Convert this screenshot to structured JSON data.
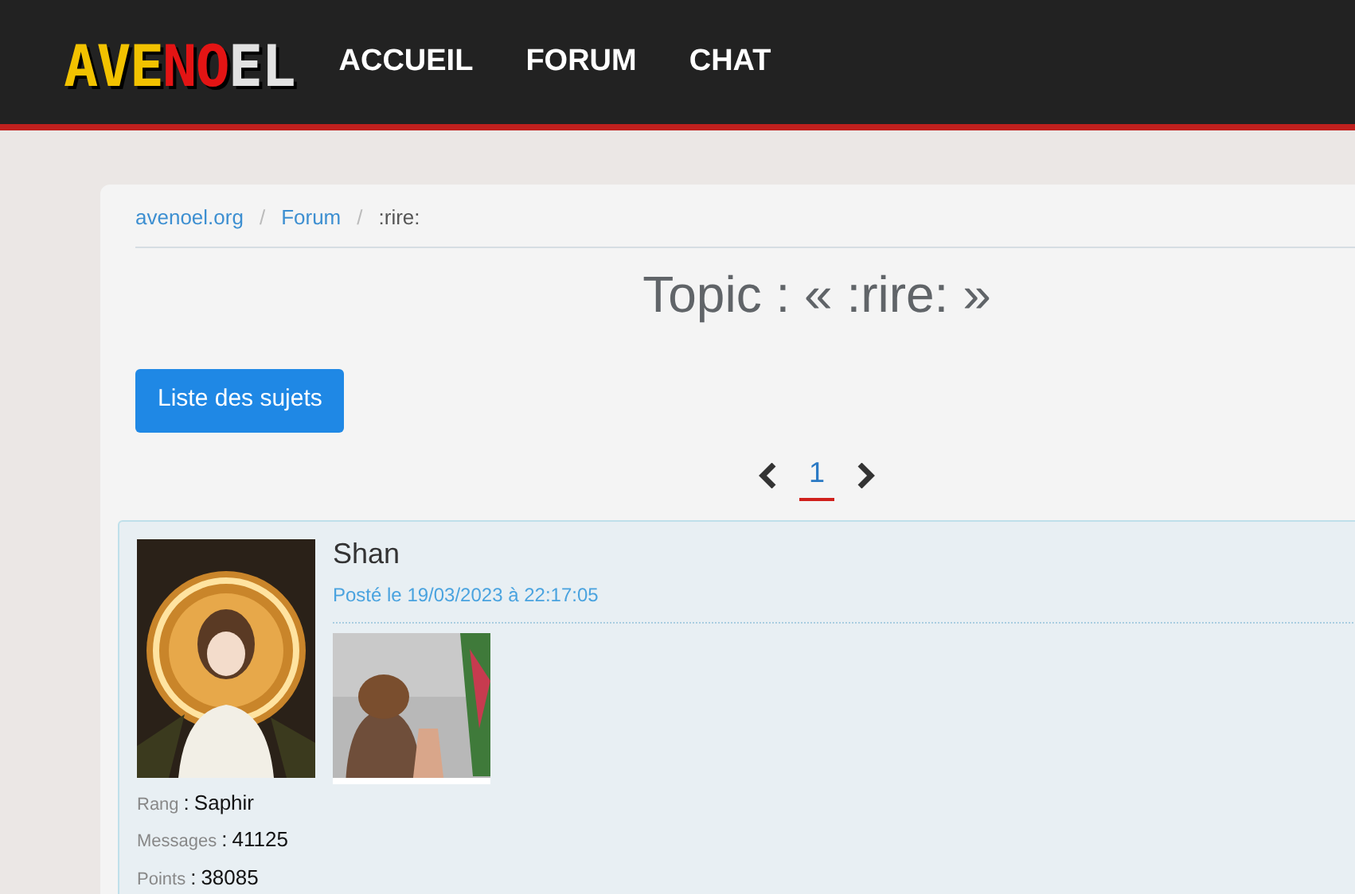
{
  "logo": [
    {
      "text": "AVE",
      "color": "#f2c200"
    },
    {
      "text": "NO",
      "color": "#e31414"
    },
    {
      "text": "EL",
      "color": "#e2e2e2"
    }
  ],
  "nav": [
    {
      "label": "ACCUEIL"
    },
    {
      "label": "FORUM"
    },
    {
      "label": "CHAT"
    }
  ],
  "breadcrumb": [
    {
      "label": "avenoel.org",
      "link": true
    },
    {
      "separator": "/",
      "label": "Forum",
      "link": true
    },
    {
      "separator": "/",
      "label": ":rire:",
      "link": false
    }
  ],
  "title": "Topic : « :rire: »",
  "list_button": "Liste des sujets",
  "pagination": {
    "pages": [
      {
        "label": "1",
        "selected": true
      }
    ]
  },
  "post": {
    "author": "Shan",
    "date": "Posté le 19/03/2023 à 22:17:05",
    "stats": [
      {
        "label": "Rang",
        "separator": ":",
        "value": "Saphir"
      },
      {
        "label": "Messages",
        "separator": ":",
        "value": "41125"
      },
      {
        "label": "Points",
        "separator": ":",
        "value": "38085"
      }
    ]
  }
}
